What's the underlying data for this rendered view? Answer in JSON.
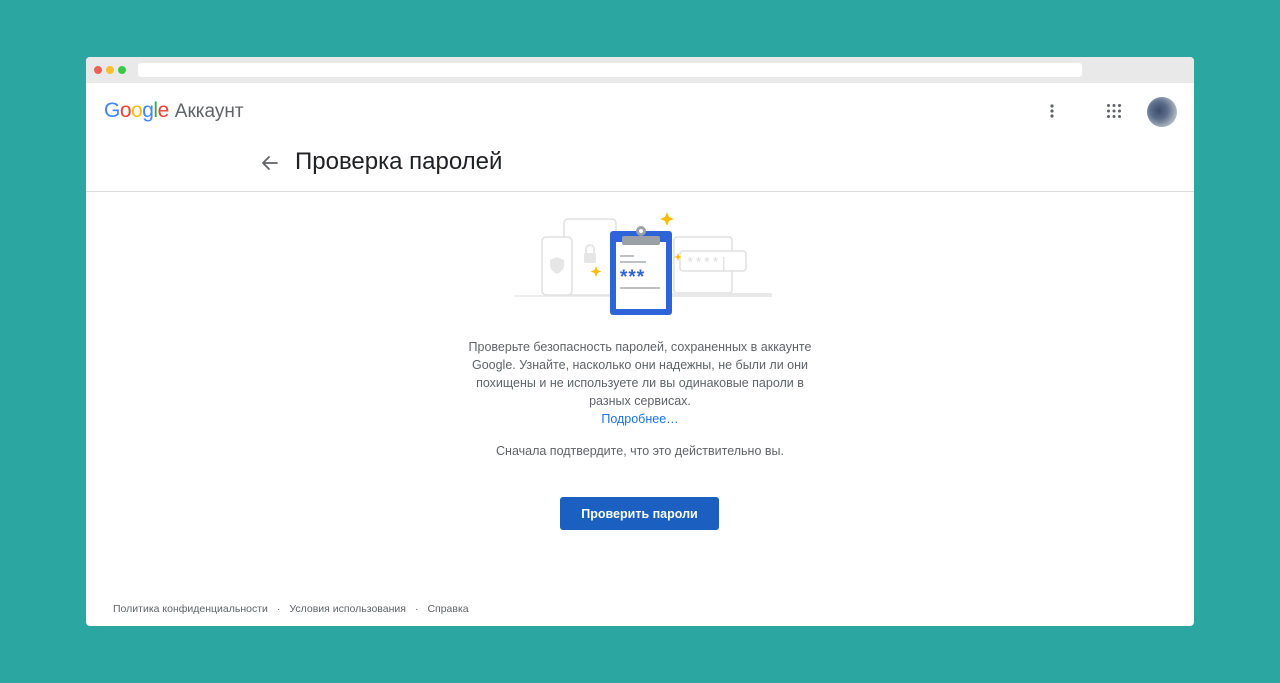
{
  "brand": {
    "logo_text": "Google",
    "product": "Аккаунт",
    "logo_colors": [
      "#4285F4",
      "#EA4335",
      "#FBBC05",
      "#4285F4",
      "#34A853",
      "#EA4335"
    ]
  },
  "header": {
    "menu_icon": "more-vert-icon",
    "apps_icon": "apps-grid-icon",
    "avatar": "user-avatar"
  },
  "page": {
    "back_icon": "arrow-back-icon",
    "title": "Проверка паролей"
  },
  "main": {
    "description": "Проверьте безопасность паролей, сохраненных в аккаунте Google. Узнайте, насколько они надежны, не были ли они похищены и не используете ли вы одинаковые пароли в разных сервисах.",
    "learn_more": "Подробнее…",
    "confirm_text": "Сначала подтвердите, что это действительно вы.",
    "button_label": "Проверить пароли",
    "illustration_mask": "***",
    "illustration_field": "****|"
  },
  "footer": {
    "links": [
      "Политика конфиденциальности",
      "Условия использования",
      "Справка"
    ],
    "separator": "·"
  },
  "colors": {
    "background": "#2ba6a1",
    "primary_button": "#1b5fc0",
    "link": "#1a73e8",
    "clipboard": "#2f64d9",
    "sparkle": "#fbbc05"
  }
}
